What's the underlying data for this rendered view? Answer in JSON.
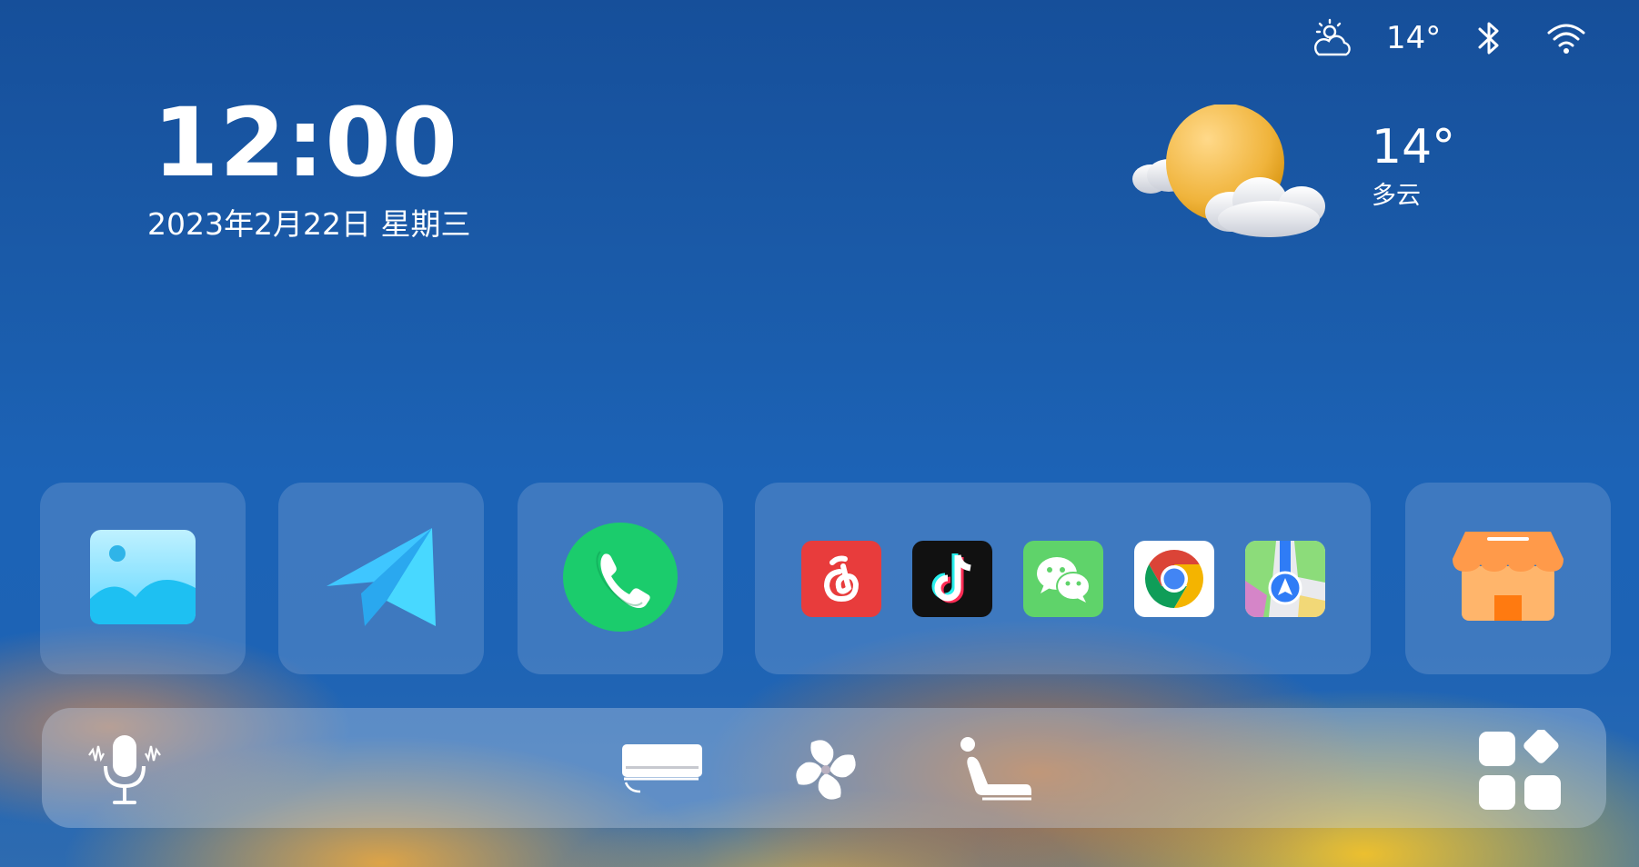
{
  "status_bar": {
    "weather_icon": "partly-cloudy-icon",
    "temperature": "14°",
    "bluetooth_icon": "bluetooth-icon",
    "wifi_icon": "wifi-icon"
  },
  "clock": {
    "time": "12:00",
    "date": "2023年2月22日 星期三"
  },
  "weather": {
    "icon": "sun-behind-clouds-icon",
    "temperature": "14°",
    "description": "多云"
  },
  "apps": {
    "gallery": "gallery-icon",
    "messenger": "paper-plane-icon",
    "phone": "phone-icon",
    "group": [
      "netease-music-icon",
      "tiktok-icon",
      "wechat-icon",
      "chrome-icon",
      "maps-icon"
    ],
    "store": "app-store-icon"
  },
  "dock": {
    "voice": "voice-assistant-icon",
    "ac": "air-conditioner-icon",
    "fan": "fan-icon",
    "seat": "seat-icon",
    "apps_grid": "apps-grid-icon"
  },
  "colors": {
    "background_top": "#164f9a",
    "netease_red": "#e83c3c",
    "tiktok_black": "#111111",
    "wechat_green": "#5fd36a",
    "phone_green": "#1bcc6c",
    "store_orange": "#ff9a4a"
  }
}
